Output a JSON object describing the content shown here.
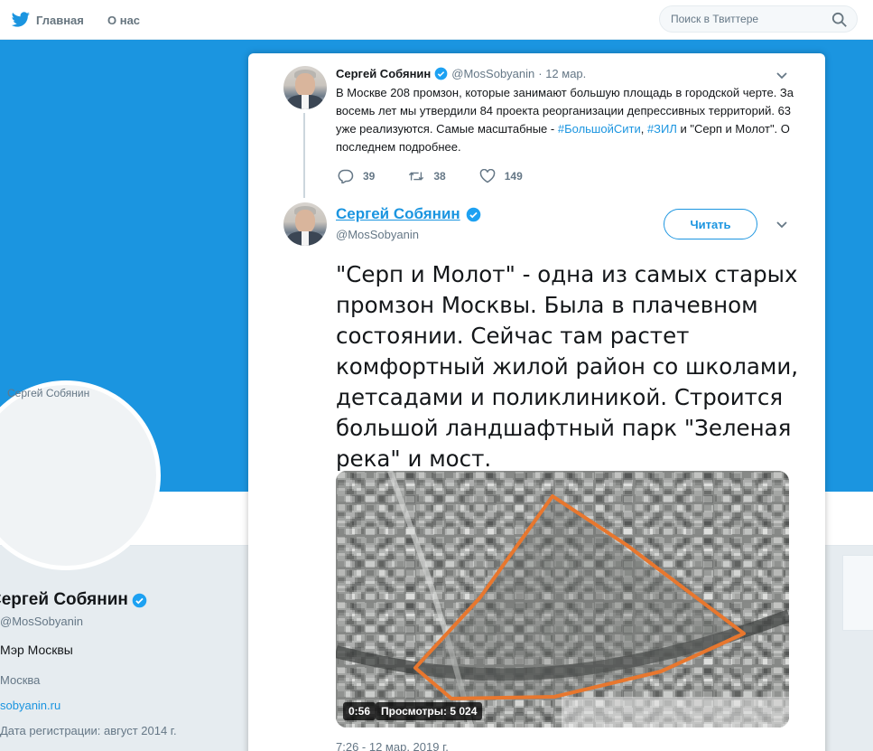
{
  "nav": {
    "home_label": "Главная",
    "about_label": "О нас",
    "search_placeholder": "Поиск в Твиттере"
  },
  "profile": {
    "avatar_alt": "Сергей Собянин",
    "name": "Сергей Собянин",
    "handle": "@MosSobyanin",
    "bio": "Мэр Москвы",
    "location": "Москва",
    "url": "sobyanin.ru",
    "joined": "Дата регистрации: август 2014 г."
  },
  "parent_tweet": {
    "name": "Сергей Собянин",
    "handle": "@MosSobyanin",
    "date": "· 12 мар.",
    "text_1": "В Москве 208 промзон, которые занимают большую площадь в городской черте. За восемь лет мы утвердили 84 проекта реорганизации депрессивных территорий. 63 уже реализуются. Самые масштабные - ",
    "hashtag_1": "#БольшойСити",
    "sep": ", ",
    "hashtag_2": "#ЗИЛ",
    "text_2": " и \"Серп и Молот\". О последнем подробнее.",
    "replies": "39",
    "retweets": "38",
    "likes": "149"
  },
  "main_tweet": {
    "name": "Сергей Собянин",
    "handle": "@MosSobyanin",
    "follow_label": "Читать",
    "text": "\"Серп и Молот\" - одна из самых старых промзон Москвы. Была в плачевном состоянии. Сейчас там растет комфортный жилой район со школами, детсадами и поликлиникой. Строится большой ландшафтный парк \"Зеленая река\" и мост.",
    "video_duration": "0:56",
    "video_views": "Просмотры: 5 024",
    "timestamp": "7:26 - 12 мар. 2019 г."
  },
  "colors": {
    "brand": "#1b95e0",
    "outline": "#e8772e"
  },
  "icons": [
    "twitter-bird-icon",
    "search-icon",
    "verified-icon",
    "chevron-down-icon",
    "reply-icon",
    "retweet-icon",
    "like-icon"
  ]
}
